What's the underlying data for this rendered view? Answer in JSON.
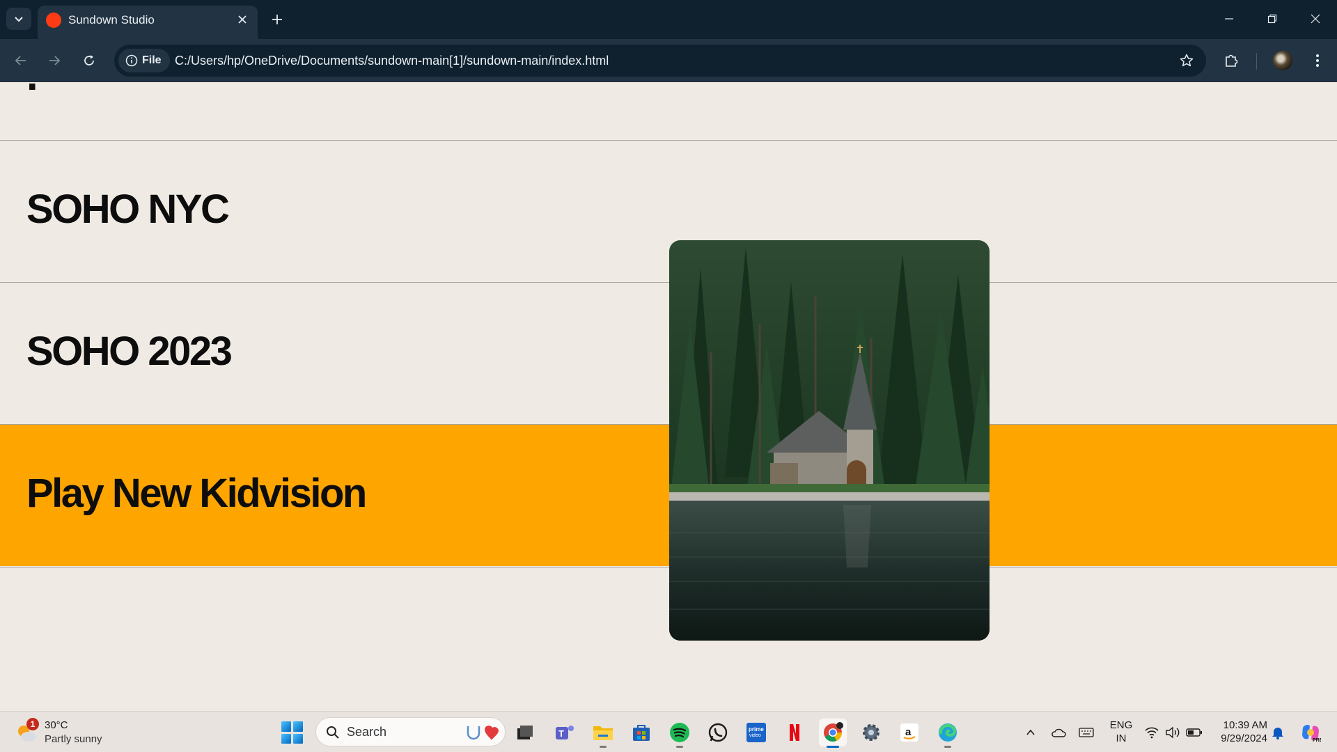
{
  "browser": {
    "tab": {
      "title": "Sundown Studio"
    },
    "address_bar": {
      "chip_label": "File",
      "url": "C:/Users/hp/OneDrive/Documents/sundown-main[1]/sundown-main/index.html"
    }
  },
  "page": {
    "rows": [
      {
        "title": "SOHO NYC"
      },
      {
        "title": "SOHO 2023"
      },
      {
        "title": "Play New Kidvision"
      }
    ],
    "highlight_color": "#ffa500",
    "image": {
      "subject": "chapel-by-lake-in-forest"
    }
  },
  "taskbar": {
    "weather": {
      "temp": "30°C",
      "desc": "Partly sunny",
      "badge": "1"
    },
    "search": {
      "label": "Search"
    },
    "tray": {
      "lang_line1": "ENG",
      "lang_line2": "IN",
      "time": "10:39 AM",
      "date": "9/29/2024"
    },
    "apps": [
      "task-view",
      "teams",
      "file-explorer",
      "microsoft-store",
      "spotify",
      "whatsapp",
      "prime-video",
      "netflix",
      "chrome",
      "settings",
      "amazon",
      "edge"
    ]
  }
}
